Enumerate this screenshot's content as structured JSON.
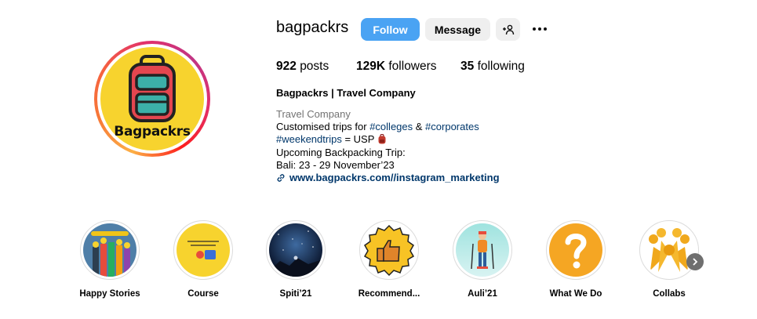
{
  "profile": {
    "username": "bagpackrs",
    "avatar_text": "Bagpackrs",
    "follow_label": "Follow",
    "message_label": "Message",
    "add_user_icon": "person-plus-icon",
    "more_icon": "ellipsis-icon"
  },
  "stats": {
    "posts_count": "922",
    "posts_label": "posts",
    "followers_count": "129K",
    "followers_label": "followers",
    "following_count": "35",
    "following_label": "following"
  },
  "bio": {
    "full_name": "Bagpackrs | Travel Company",
    "category": "Travel Company",
    "line1_prefix": "Customised trips for ",
    "tag_colleges": "#colleges",
    "line1_and": " & ",
    "tag_corporates": "#corporates",
    "tag_weekendtrips": "#weekendtrips",
    "line2_suffix": " = USP",
    "line3": "Upcoming Backpacking Trip:",
    "line4": "Bali: 23 - 29 November’23",
    "link": "www.bagpackrs.com//instagram_marketing"
  },
  "highlights": [
    {
      "label": "Happy Stories"
    },
    {
      "label": "Course"
    },
    {
      "label": "Spiti’21"
    },
    {
      "label": "Recommend..."
    },
    {
      "label": "Auli’21"
    },
    {
      "label": "What We Do"
    },
    {
      "label": "Collabs"
    }
  ],
  "colors": {
    "follow_button": "#4aa3f3",
    "link": "#00376b",
    "avatar_bg": "#f7d32e"
  }
}
